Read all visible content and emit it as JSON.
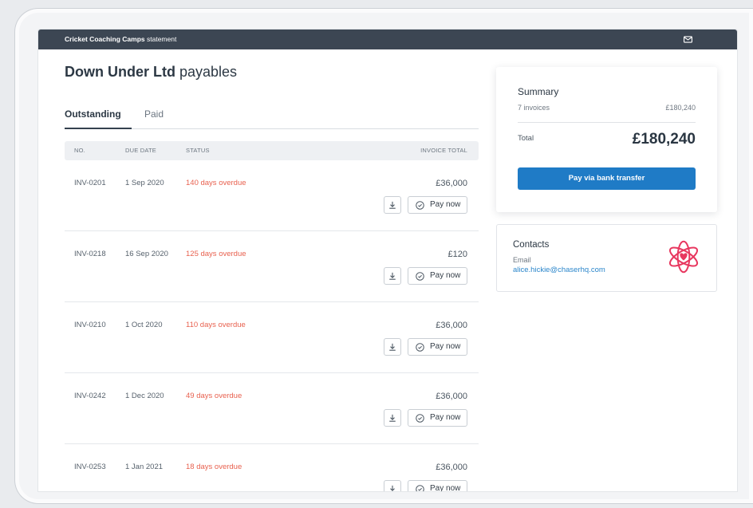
{
  "header": {
    "company": "Cricket Coaching Camps",
    "suffix": "statement"
  },
  "page": {
    "customer": "Down Under Ltd",
    "title_suffix": "payables"
  },
  "tabs": [
    {
      "label": "Outstanding",
      "active": true
    },
    {
      "label": "Paid",
      "active": false
    }
  ],
  "table": {
    "columns": {
      "no": "NO.",
      "due_date": "DUE DATE",
      "status": "STATUS",
      "total": "INVOICE TOTAL"
    },
    "pay_now_label": "Pay now",
    "rows": [
      {
        "no": "INV-0201",
        "due_date": "1 Sep 2020",
        "status": "140 days overdue",
        "total": "£36,000"
      },
      {
        "no": "INV-0218",
        "due_date": "16 Sep 2020",
        "status": "125 days overdue",
        "total": "£120"
      },
      {
        "no": "INV-0210",
        "due_date": "1 Oct 2020",
        "status": "110 days overdue",
        "total": "£36,000"
      },
      {
        "no": "INV-0242",
        "due_date": "1 Dec 2020",
        "status": "49 days overdue",
        "total": "£36,000"
      },
      {
        "no": "INV-0253",
        "due_date": "1 Jan 2021",
        "status": "18 days overdue",
        "total": "£36,000"
      }
    ]
  },
  "summary": {
    "title": "Summary",
    "count_label": "7 invoices",
    "count_amount": "£180,240",
    "total_label": "Total",
    "total_amount": "£180,240",
    "pay_button": "Pay via bank transfer"
  },
  "contacts": {
    "title": "Contacts",
    "email_label": "Email",
    "email": "alice.hickie@chaserhq.com"
  },
  "icons": {
    "mail": "mail-icon",
    "download": "download-icon",
    "pay": "check-circle-icon",
    "logo": "atom-heart-logo"
  },
  "colors": {
    "header_bar": "#3c4653",
    "accent": "#1f7bc6",
    "overdue": "#e8614f",
    "link": "#2b86cb",
    "logo": "#e8375f"
  }
}
